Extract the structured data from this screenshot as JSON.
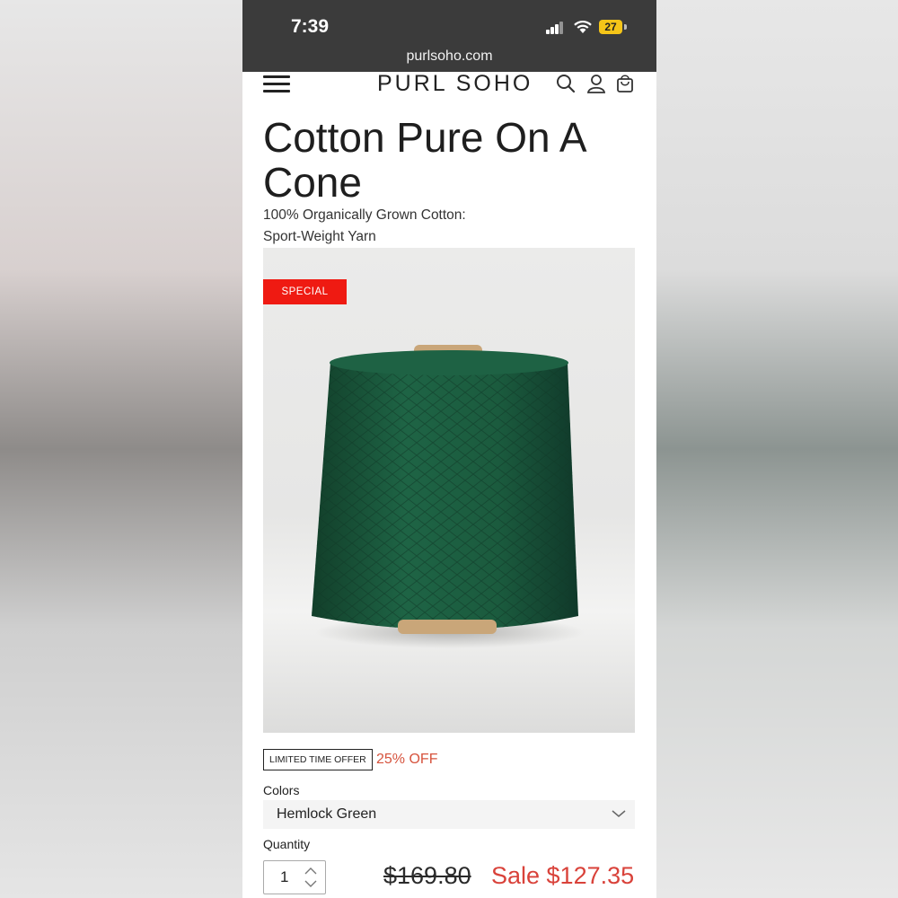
{
  "status_bar": {
    "time": "7:39",
    "battery": "27",
    "url": "purlsoho.com"
  },
  "nav": {
    "logo": "PURL SOHO",
    "icons": [
      "menu-icon",
      "search-icon",
      "account-icon",
      "cart-icon"
    ]
  },
  "product": {
    "title": "Cotton Pure On A Cone",
    "subtitle_line1": "100% Organically Grown Cotton:",
    "subtitle_line2": "Sport-Weight Yarn",
    "badge": "SPECIAL",
    "offer_badge": "LIMITED TIME OFFER",
    "offer_percent": "25% OFF",
    "colors_label": "Colors",
    "color_selected": "Hemlock Green",
    "quantity_label": "Quantity",
    "quantity_value": "1",
    "price_original": "$169.80",
    "price_sale": "Sale $127.35"
  },
  "colors": {
    "sale_red": "#d9423a",
    "badge_red": "#ef1a12",
    "offer_orange": "#d6533d",
    "yarn_green": "#1c5a3c"
  }
}
